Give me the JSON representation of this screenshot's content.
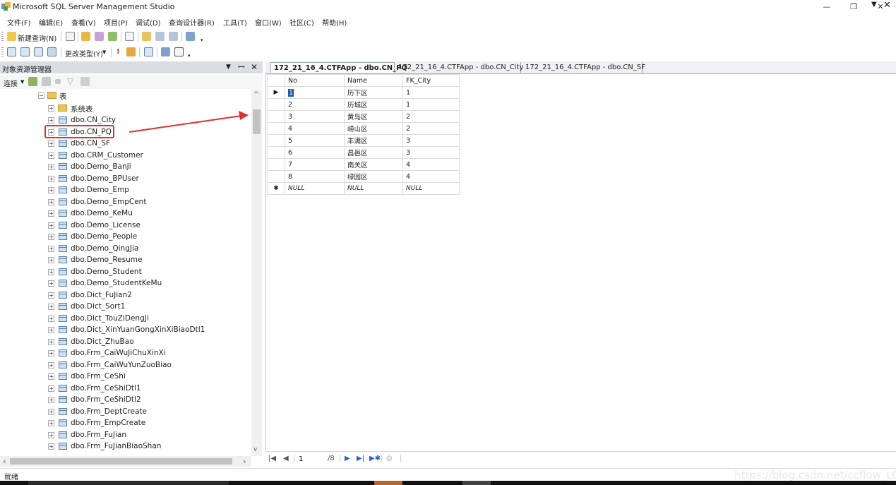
{
  "window": {
    "title": "Microsoft SQL Server Management Studio",
    "minimize": "—",
    "maximize": "❐",
    "close": "✕"
  },
  "menu": [
    "文件(F)",
    "编辑(E)",
    "查看(V)",
    "项目(P)",
    "调试(D)",
    "查询设计器(R)",
    "工具(T)",
    "窗口(W)",
    "社区(C)",
    "帮助(H)"
  ],
  "toolbar1": {
    "new_query_label": "新建查询(N)"
  },
  "toolbar2": {
    "change_type_label": "更改类型(Y)"
  },
  "object_explorer": {
    "title": "对象资源管理器",
    "pin": "ꟷ",
    "close": "✕",
    "dropdown": "▼",
    "connect_label": "连接",
    "tables_folder": "表",
    "system_tables": "系统表",
    "tables": [
      "dbo.CN_City",
      "dbo.CN_PQ",
      "dbo.CN_SF",
      "dbo.CRM_Customer",
      "dbo.Demo_BanJi",
      "dbo.Demo_BPUser",
      "dbo.Demo_Emp",
      "dbo.Demo_EmpCent",
      "dbo.Demo_KeMu",
      "dbo.Demo_License",
      "dbo.Demo_People",
      "dbo.Demo_QingJia",
      "dbo.Demo_Resume",
      "dbo.Demo_Student",
      "dbo.Demo_StudentKeMu",
      "dbo.Dict_FuJian2",
      "dbo.Dict_Sort1",
      "dbo.Dict_TouZiDengJi",
      "dbo.Dict_XinYuanGongXinXiBiaoDtl1",
      "dbo.Dict_ZhuBao",
      "dbo.Frm_CaiWuJiChuXinXi",
      "dbo.Frm_CaiWuYunZuoBiao",
      "dbo.Frm_CeShi",
      "dbo.Frm_CeShiDtl1",
      "dbo.Frm_CeShiDtl2",
      "dbo.Frm_DeptCreate",
      "dbo.Frm_EmpCreate",
      "dbo.Frm_FuJian",
      "dbo.Frm_FuJianBiaoShan"
    ],
    "selected_table": "dbo.CN_PQ"
  },
  "doc_tabs": [
    {
      "label": "172_21_16_4.CTFApp - dbo.CN_PQ",
      "active": true
    },
    {
      "label": "172_21_16_4.CTFApp - dbo.CN_City",
      "active": false
    },
    {
      "label": "172_21_16_4.CTFApp - dbo.CN_SF",
      "active": false
    }
  ],
  "grid": {
    "columns": [
      "No",
      "Name",
      "FK_City"
    ],
    "rows": [
      [
        "1",
        "历下区",
        "1"
      ],
      [
        "2",
        "历城区",
        "1"
      ],
      [
        "3",
        "黄岛区",
        "2"
      ],
      [
        "4",
        "崂山区",
        "2"
      ],
      [
        "5",
        "丰满区",
        "3"
      ],
      [
        "6",
        "昌邑区",
        "3"
      ],
      [
        "7",
        "南关区",
        "4"
      ],
      [
        "8",
        "绿园区",
        "4"
      ]
    ],
    "new_row": [
      "NULL",
      "NULL",
      "NULL"
    ],
    "current_row_marker": "▶",
    "new_row_marker": "✱"
  },
  "navigator": {
    "current_record": "1",
    "total_records": "/8"
  },
  "status": {
    "text": "就绪",
    "watermark": "https://blog.csdn.net/ccflow_LO"
  },
  "colors": {
    "highlight": "#e03030",
    "active_tab_border": "#9aa7bd",
    "panel_header": "#dadde3"
  }
}
